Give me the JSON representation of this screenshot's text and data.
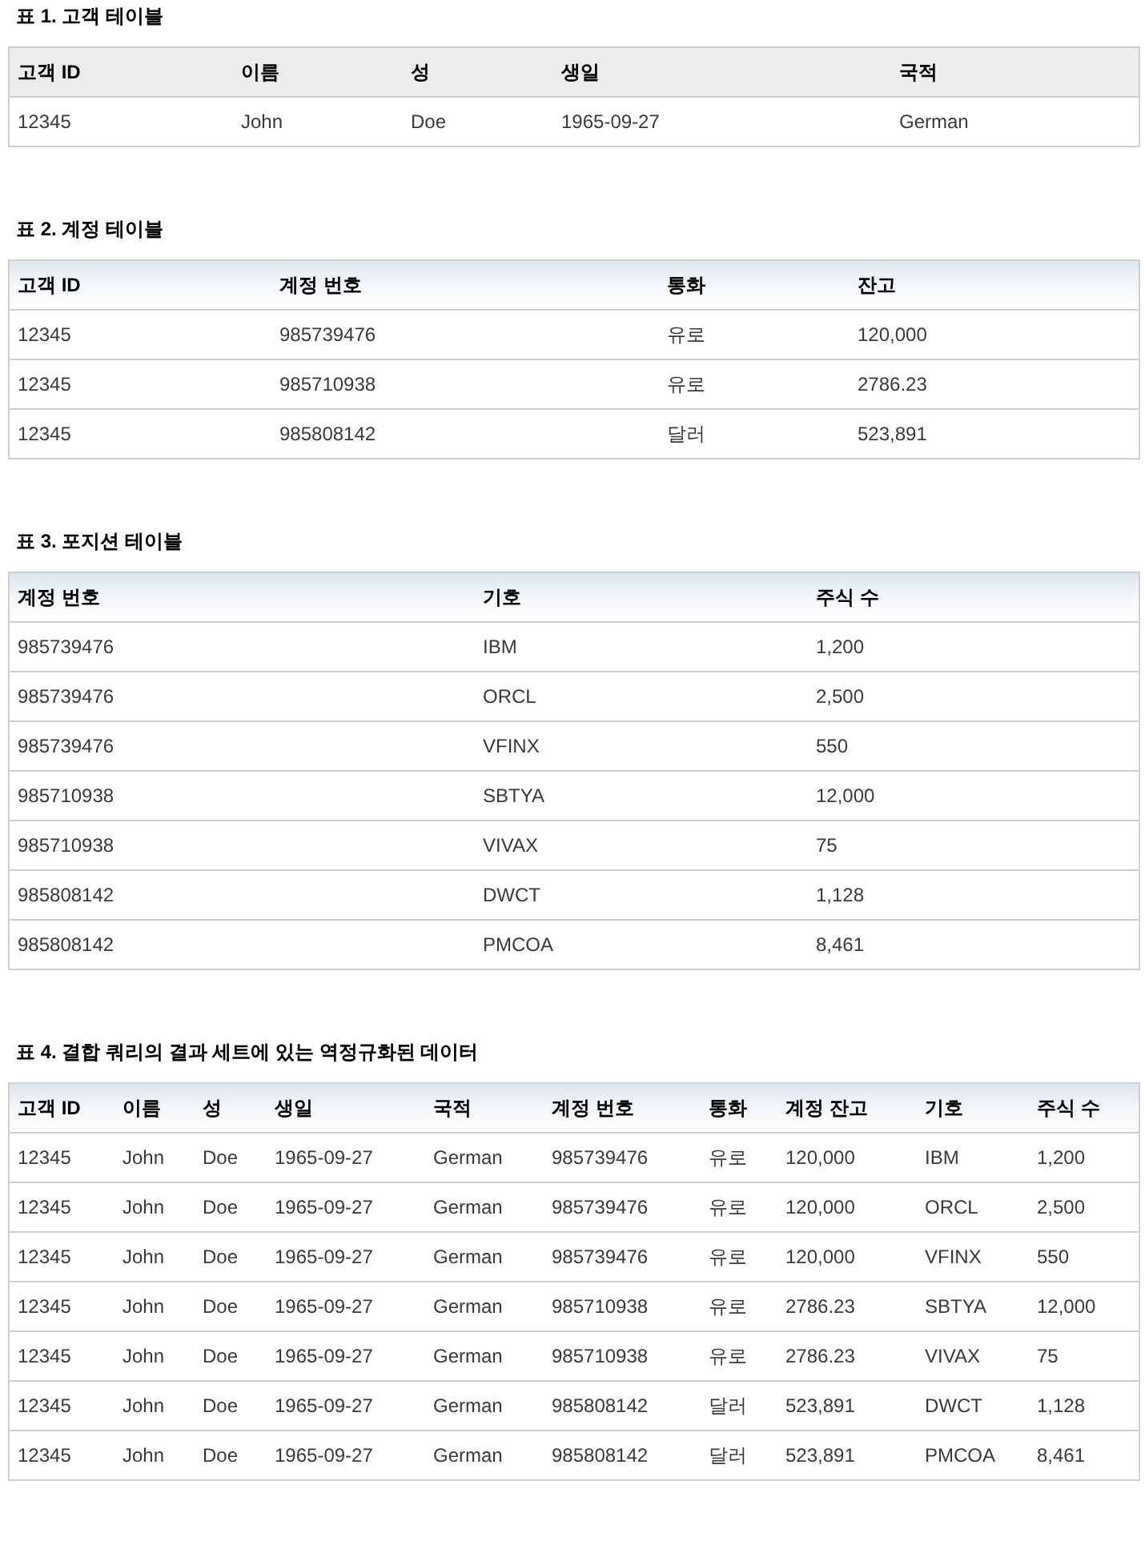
{
  "tables": [
    {
      "title": "표 1. 고객 테이블",
      "kind": "plain",
      "columns": [
        "고객 ID",
        "이름",
        "성",
        "생일",
        "국적"
      ],
      "rows": [
        [
          "12345",
          "John",
          "Doe",
          "1965-09-27",
          "German"
        ]
      ]
    },
    {
      "title": "표 2. 계정 테이블",
      "kind": "gradient",
      "columns": [
        "고객 ID",
        "계정 번호",
        "통화",
        "잔고"
      ],
      "rows": [
        [
          "12345",
          "985739476",
          "유로",
          "120,000"
        ],
        [
          "12345",
          "985710938",
          "유로",
          "2786.23"
        ],
        [
          "12345",
          "985808142",
          "달러",
          "523,891"
        ]
      ]
    },
    {
      "title": "표 3. 포지션 테이블",
      "kind": "gradient",
      "columns": [
        "계정 번호",
        "기호",
        "주식 수"
      ],
      "rows": [
        [
          "985739476",
          "IBM",
          "1,200"
        ],
        [
          "985739476",
          "ORCL",
          "2,500"
        ],
        [
          "985739476",
          "VFINX",
          "550"
        ],
        [
          "985710938",
          "SBTYA",
          "12,000"
        ],
        [
          "985710938",
          "VIVAX",
          "75"
        ],
        [
          "985808142",
          "DWCT",
          "1,128"
        ],
        [
          "985808142",
          "PMCOA",
          "8,461"
        ]
      ]
    },
    {
      "title": "표 4. 결합 쿼리의 결과 세트에 있는 역정규화된 데이터",
      "kind": "gradient",
      "columns": [
        "고객 ID",
        "이름",
        "성",
        "생일",
        "국적",
        "계정 번호",
        "통화",
        "계정 잔고",
        "기호",
        "주식 수"
      ],
      "rows": [
        [
          "12345",
          "John",
          "Doe",
          "1965-09-27",
          "German",
          "985739476",
          "유로",
          "120,000",
          "IBM",
          "1,200"
        ],
        [
          "12345",
          "John",
          "Doe",
          "1965-09-27",
          "German",
          "985739476",
          "유로",
          "120,000",
          "ORCL",
          "2,500"
        ],
        [
          "12345",
          "John",
          "Doe",
          "1965-09-27",
          "German",
          "985739476",
          "유로",
          "120,000",
          "VFINX",
          "550"
        ],
        [
          "12345",
          "John",
          "Doe",
          "1965-09-27",
          "German",
          "985710938",
          "유로",
          "2786.23",
          "SBTYA",
          "12,000"
        ],
        [
          "12345",
          "John",
          "Doe",
          "1965-09-27",
          "German",
          "985710938",
          "유로",
          "2786.23",
          "VIVAX",
          "75"
        ],
        [
          "12345",
          "John",
          "Doe",
          "1965-09-27",
          "German",
          "985808142",
          "달러",
          "523,891",
          "DWCT",
          "1,128"
        ],
        [
          "12345",
          "John",
          "Doe",
          "1965-09-27",
          "German",
          "985808142",
          "달러",
          "523,891",
          "PMCOA",
          "8,461"
        ]
      ]
    }
  ]
}
